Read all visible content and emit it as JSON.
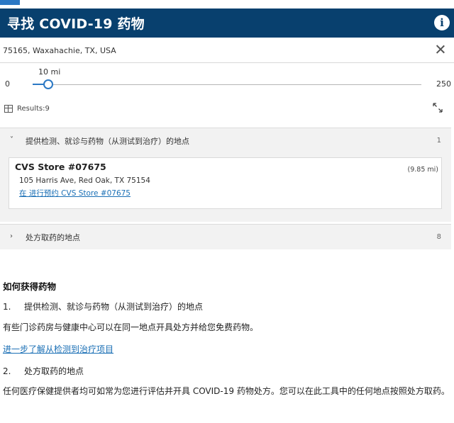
{
  "colors": {
    "header_bg": "#08406e",
    "accent": "#2b78c4",
    "link": "#1a6fb5"
  },
  "header": {
    "title": "寻找 COVID-19 药物",
    "info_icon": "i"
  },
  "search": {
    "value": "75165, Waxahachie, TX, USA",
    "clear_icon": "close-icon"
  },
  "distance": {
    "min_label": "0",
    "max_label": "250",
    "value_label": "10 mi",
    "value": 10,
    "min": 0,
    "max": 250
  },
  "results": {
    "label": "Results:9",
    "expand_icon": "expand-icon"
  },
  "groups": [
    {
      "chevron": "˅",
      "label": "提供检测、就诊与药物（从测试到治疗）的地点",
      "count": "1",
      "expanded": true,
      "stores": [
        {
          "name": "CVS Store #07675",
          "distance": "(9.85 mi)",
          "address": "105 Harris Ave, Red Oak, TX 75154",
          "link": "在 进行预约 CVS Store #07675"
        }
      ]
    },
    {
      "chevron": "›",
      "label": "处方取药的地点",
      "count": "8",
      "expanded": false
    }
  ],
  "info": {
    "heading": "如何获得药物",
    "item1_num": "1.",
    "item1_label": "提供检测、就诊与药物（从测试到治疗）的地点",
    "item1_text": "有些门诊药房与健康中心可以在同一地点开具处方并给您免费药物。",
    "item1_link": "进一步了解从检测到治疗项目",
    "item2_num": "2.",
    "item2_label": "处方取药的地点",
    "item2_text": "任何医疗保健提供者均可如常为您进行评估并开具 COVID-19 药物处方。您可以在此工具中的任何地点按照处方取药。"
  }
}
